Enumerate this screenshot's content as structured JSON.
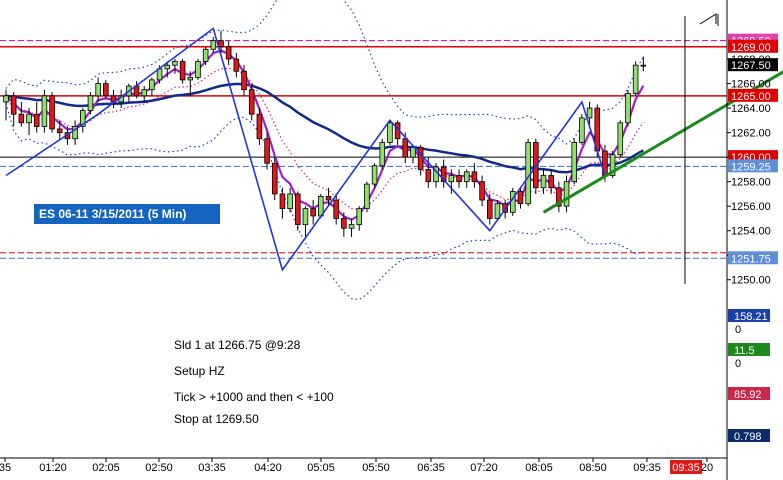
{
  "chart_data": {
    "type": "candlestick",
    "title": "ES 06-11  3/15/2011 (5 Min)",
    "x_tick_labels": [
      "35",
      "01:20",
      "02:05",
      "02:50",
      "03:35",
      "04:20",
      "05:05",
      "05:50",
      "06:35",
      "07:20",
      "08:05",
      "08:50",
      "09:35",
      "20"
    ],
    "current_time_label": "09:35",
    "y_range": [
      1249,
      1272
    ],
    "y_tick_values": [
      1250,
      1252,
      1254,
      1256,
      1258,
      1260,
      1262,
      1264,
      1266,
      1268
    ],
    "y_tick_labels": [
      "1250.00",
      "1252.00",
      "1254.00",
      "1256.00",
      "1258.00",
      "1260.00",
      "1262.00",
      "1264.00",
      "1266.00",
      "1268.00"
    ],
    "price_levels": [
      {
        "label": "1269.50",
        "value": 1269.5,
        "style": "dashed",
        "color": "#d0008f",
        "badge": "#e040b0"
      },
      {
        "label": "1269.00",
        "value": 1269.0,
        "style": "solid",
        "color": "#e00000",
        "badge": "#e00000"
      },
      {
        "label": "1267.50",
        "value": 1267.5,
        "style": "none",
        "color": "#000000",
        "badge": "#000000"
      },
      {
        "label": "1265.00",
        "value": 1265.0,
        "style": "solid",
        "color": "#e00000",
        "badge": "#e00000"
      },
      {
        "label": "1260.00",
        "value": 1260.0,
        "style": "solid-thin",
        "color": "#000000",
        "badge": "#e00000"
      },
      {
        "label": "1259.25",
        "value": 1259.25,
        "style": "dashed",
        "color": "#3070e0",
        "badge": "#5f8fd8"
      },
      {
        "label": "",
        "value": 1252.2,
        "style": "dashed",
        "color": "#e00000",
        "badge": ""
      },
      {
        "label": "1251.75",
        "value": 1251.75,
        "style": "dashed",
        "color": "#3070e0",
        "badge": "#5f8fd8"
      }
    ],
    "candles": [
      {
        "o": 1264.5,
        "h": 1265.5,
        "l": 1263.0,
        "c": 1265.0
      },
      {
        "o": 1265.0,
        "h": 1265.3,
        "l": 1262.5,
        "c": 1263.5
      },
      {
        "o": 1263.5,
        "h": 1264.5,
        "l": 1262.5,
        "c": 1262.8
      },
      {
        "o": 1262.8,
        "h": 1264.0,
        "l": 1261.8,
        "c": 1263.5
      },
      {
        "o": 1263.5,
        "h": 1264.5,
        "l": 1262.0,
        "c": 1262.5
      },
      {
        "o": 1262.5,
        "h": 1265.5,
        "l": 1262.0,
        "c": 1265.0
      },
      {
        "o": 1265.0,
        "h": 1265.3,
        "l": 1262.0,
        "c": 1262.3
      },
      {
        "o": 1262.3,
        "h": 1263.0,
        "l": 1261.5,
        "c": 1262.0
      },
      {
        "o": 1262.0,
        "h": 1262.5,
        "l": 1261.0,
        "c": 1261.5
      },
      {
        "o": 1261.5,
        "h": 1263.0,
        "l": 1261.0,
        "c": 1262.5
      },
      {
        "o": 1262.5,
        "h": 1264.0,
        "l": 1262.0,
        "c": 1263.8
      },
      {
        "o": 1263.8,
        "h": 1265.3,
        "l": 1263.5,
        "c": 1265.0
      },
      {
        "o": 1265.0,
        "h": 1266.5,
        "l": 1264.5,
        "c": 1266.0
      },
      {
        "o": 1266.0,
        "h": 1266.3,
        "l": 1264.8,
        "c": 1265.0
      },
      {
        "o": 1265.0,
        "h": 1265.5,
        "l": 1264.0,
        "c": 1264.5
      },
      {
        "o": 1264.5,
        "h": 1265.5,
        "l": 1264.0,
        "c": 1265.0
      },
      {
        "o": 1265.0,
        "h": 1266.0,
        "l": 1264.5,
        "c": 1265.8
      },
      {
        "o": 1265.8,
        "h": 1266.2,
        "l": 1264.8,
        "c": 1265.0
      },
      {
        "o": 1265.0,
        "h": 1265.8,
        "l": 1264.5,
        "c": 1265.5
      },
      {
        "o": 1265.5,
        "h": 1266.5,
        "l": 1265.0,
        "c": 1266.3
      },
      {
        "o": 1266.3,
        "h": 1267.5,
        "l": 1266.0,
        "c": 1267.2
      },
      {
        "o": 1267.2,
        "h": 1267.8,
        "l": 1266.5,
        "c": 1267.5
      },
      {
        "o": 1267.5,
        "h": 1268.0,
        "l": 1266.8,
        "c": 1267.8
      },
      {
        "o": 1267.8,
        "h": 1268.0,
        "l": 1266.0,
        "c": 1266.3
      },
      {
        "o": 1266.3,
        "h": 1267.0,
        "l": 1265.0,
        "c": 1266.5
      },
      {
        "o": 1266.5,
        "h": 1268.0,
        "l": 1266.3,
        "c": 1267.8
      },
      {
        "o": 1267.8,
        "h": 1269.0,
        "l": 1267.5,
        "c": 1268.8
      },
      {
        "o": 1268.8,
        "h": 1269.8,
        "l": 1268.5,
        "c": 1269.5
      },
      {
        "o": 1269.5,
        "h": 1270.3,
        "l": 1268.5,
        "c": 1269.0
      },
      {
        "o": 1269.0,
        "h": 1269.5,
        "l": 1267.5,
        "c": 1268.0
      },
      {
        "o": 1268.0,
        "h": 1268.5,
        "l": 1266.5,
        "c": 1267.0
      },
      {
        "o": 1267.0,
        "h": 1267.5,
        "l": 1265.0,
        "c": 1265.5
      },
      {
        "o": 1265.5,
        "h": 1266.0,
        "l": 1263.0,
        "c": 1263.5
      },
      {
        "o": 1263.5,
        "h": 1264.0,
        "l": 1261.0,
        "c": 1261.5
      },
      {
        "o": 1261.5,
        "h": 1262.0,
        "l": 1259.0,
        "c": 1259.5
      },
      {
        "o": 1259.5,
        "h": 1260.0,
        "l": 1256.5,
        "c": 1257.0
      },
      {
        "o": 1257.0,
        "h": 1257.5,
        "l": 1255.0,
        "c": 1255.8
      },
      {
        "o": 1255.8,
        "h": 1257.5,
        "l": 1255.5,
        "c": 1257.0
      },
      {
        "o": 1257.0,
        "h": 1257.2,
        "l": 1254.0,
        "c": 1254.5
      },
      {
        "o": 1254.5,
        "h": 1256.0,
        "l": 1253.5,
        "c": 1255.8
      },
      {
        "o": 1255.8,
        "h": 1256.5,
        "l": 1254.5,
        "c": 1255.2
      },
      {
        "o": 1255.2,
        "h": 1257.0,
        "l": 1255.0,
        "c": 1256.8
      },
      {
        "o": 1256.8,
        "h": 1257.5,
        "l": 1256.0,
        "c": 1256.5
      },
      {
        "o": 1256.5,
        "h": 1257.0,
        "l": 1254.5,
        "c": 1255.0
      },
      {
        "o": 1255.0,
        "h": 1255.5,
        "l": 1253.5,
        "c": 1254.2
      },
      {
        "o": 1254.2,
        "h": 1255.0,
        "l": 1253.5,
        "c": 1254.5
      },
      {
        "o": 1254.5,
        "h": 1256.0,
        "l": 1254.0,
        "c": 1255.8
      },
      {
        "o": 1255.8,
        "h": 1258.0,
        "l": 1255.5,
        "c": 1257.8
      },
      {
        "o": 1257.8,
        "h": 1259.5,
        "l": 1257.5,
        "c": 1259.3
      },
      {
        "o": 1259.3,
        "h": 1261.5,
        "l": 1259.0,
        "c": 1261.2
      },
      {
        "o": 1261.2,
        "h": 1263.0,
        "l": 1261.0,
        "c": 1262.8
      },
      {
        "o": 1262.8,
        "h": 1263.0,
        "l": 1261.0,
        "c": 1261.5
      },
      {
        "o": 1261.5,
        "h": 1262.0,
        "l": 1259.5,
        "c": 1260.0
      },
      {
        "o": 1260.0,
        "h": 1261.0,
        "l": 1259.5,
        "c": 1260.8
      },
      {
        "o": 1260.8,
        "h": 1261.0,
        "l": 1258.5,
        "c": 1259.0
      },
      {
        "o": 1259.0,
        "h": 1260.0,
        "l": 1257.5,
        "c": 1258.0
      },
      {
        "o": 1258.0,
        "h": 1259.5,
        "l": 1257.5,
        "c": 1259.2
      },
      {
        "o": 1259.2,
        "h": 1259.8,
        "l": 1257.5,
        "c": 1258.0
      },
      {
        "o": 1258.0,
        "h": 1259.0,
        "l": 1257.0,
        "c": 1258.5
      },
      {
        "o": 1258.5,
        "h": 1259.0,
        "l": 1257.5,
        "c": 1258.0
      },
      {
        "o": 1258.0,
        "h": 1259.0,
        "l": 1257.5,
        "c": 1258.8
      },
      {
        "o": 1258.8,
        "h": 1259.5,
        "l": 1257.5,
        "c": 1258.0
      },
      {
        "o": 1258.0,
        "h": 1258.5,
        "l": 1256.0,
        "c": 1256.5
      },
      {
        "o": 1256.5,
        "h": 1257.0,
        "l": 1254.5,
        "c": 1255.0
      },
      {
        "o": 1255.0,
        "h": 1256.5,
        "l": 1254.8,
        "c": 1256.2
      },
      {
        "o": 1256.2,
        "h": 1256.5,
        "l": 1255.0,
        "c": 1255.5
      },
      {
        "o": 1255.5,
        "h": 1257.5,
        "l": 1255.2,
        "c": 1257.2
      },
      {
        "o": 1257.2,
        "h": 1257.5,
        "l": 1255.8,
        "c": 1256.2
      },
      {
        "o": 1256.2,
        "h": 1261.5,
        "l": 1256.0,
        "c": 1261.2
      },
      {
        "o": 1261.2,
        "h": 1261.5,
        "l": 1257.0,
        "c": 1257.5
      },
      {
        "o": 1257.5,
        "h": 1259.0,
        "l": 1257.0,
        "c": 1258.5
      },
      {
        "o": 1258.5,
        "h": 1259.0,
        "l": 1257.0,
        "c": 1257.5
      },
      {
        "o": 1257.5,
        "h": 1258.0,
        "l": 1255.5,
        "c": 1256.0
      },
      {
        "o": 1256.0,
        "h": 1258.5,
        "l": 1255.5,
        "c": 1258.0
      },
      {
        "o": 1258.0,
        "h": 1261.5,
        "l": 1257.8,
        "c": 1261.2
      },
      {
        "o": 1261.2,
        "h": 1263.5,
        "l": 1261.0,
        "c": 1263.2
      },
      {
        "o": 1263.2,
        "h": 1264.5,
        "l": 1262.5,
        "c": 1264.0
      },
      {
        "o": 1264.0,
        "h": 1264.3,
        "l": 1260.0,
        "c": 1260.5
      },
      {
        "o": 1260.5,
        "h": 1261.0,
        "l": 1258.0,
        "c": 1258.5
      },
      {
        "o": 1258.5,
        "h": 1260.5,
        "l": 1258.3,
        "c": 1260.2
      },
      {
        "o": 1260.2,
        "h": 1263.0,
        "l": 1260.0,
        "c": 1262.8
      },
      {
        "o": 1262.8,
        "h": 1265.5,
        "l": 1262.5,
        "c": 1265.2
      },
      {
        "o": 1265.2,
        "h": 1267.8,
        "l": 1265.0,
        "c": 1267.5
      },
      {
        "o": 1267.5,
        "h": 1268.2,
        "l": 1267.0,
        "c": 1267.5
      }
    ],
    "trend_line_points": [
      [
        0,
        1258.5
      ],
      [
        12,
        1263.5
      ],
      [
        27,
        1270.5
      ],
      [
        36,
        1250.8
      ],
      [
        50,
        1263.0
      ],
      [
        63,
        1254.0
      ],
      [
        75,
        1264.5
      ],
      [
        78,
        1258.5
      ]
    ],
    "uptrend_line": [
      [
        70,
        1255.5
      ],
      [
        91,
        1267.5
      ]
    ],
    "indicator_panels": [
      {
        "value_label": "158.21",
        "zero_label": "0",
        "badge_color": "#1a3fa8",
        "value_color": "#ffffff"
      },
      {
        "value_label": "11.5",
        "zero_label": "0",
        "badge_color": "#1e8a1e",
        "value_color": "#ffffff"
      },
      {
        "value_label": "85.92",
        "zero_label": "",
        "badge_color": "#c8284a",
        "value_color": "#ffffff"
      },
      {
        "value_label": "0.798",
        "zero_label": "",
        "badge_color": "#0a2a6a",
        "value_color": "#ffffff"
      }
    ]
  },
  "notes": [
    "Sld 1 at 1266.75    @9:28",
    "Setup HZ",
    "Tick > +1000 and then < +100",
    " Stop at 1269.50"
  ]
}
